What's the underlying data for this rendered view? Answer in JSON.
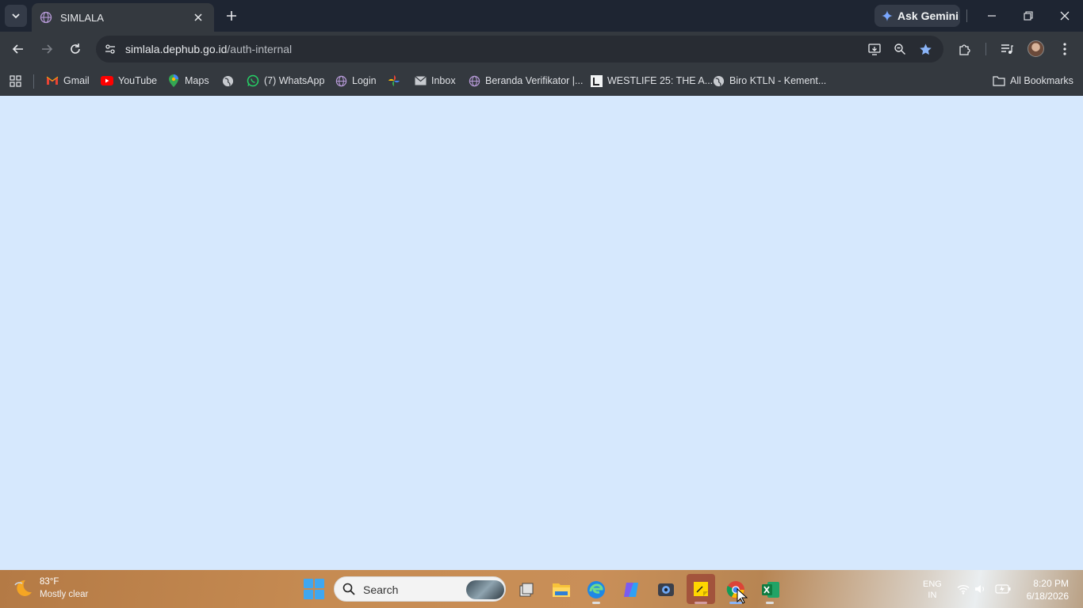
{
  "browser": {
    "tab": {
      "title": "SIMLALA"
    },
    "gemini_label": "Ask Gemini",
    "url": {
      "host": "simlala.dephub.go.id",
      "path": "/auth-internal"
    }
  },
  "bookmarks": [
    {
      "label": "Gmail",
      "icon": "gmail-icon"
    },
    {
      "label": "YouTube",
      "icon": "youtube-icon"
    },
    {
      "label": "Maps",
      "icon": "maps-icon"
    },
    {
      "label": "",
      "icon": "globe-icon"
    },
    {
      "label": "(7) WhatsApp",
      "icon": "whatsapp-icon"
    },
    {
      "label": "Login",
      "icon": "globe-icon"
    },
    {
      "label": "",
      "icon": "pinwheel-icon"
    },
    {
      "label": "Inbox",
      "icon": "mail-icon"
    },
    {
      "label": "Beranda Verifikator |...",
      "icon": "globe-icon"
    },
    {
      "label": "WESTLIFE 25: THE A...",
      "icon": "letter-l-icon"
    },
    {
      "label": "Biro KTLN - Kement...",
      "icon": "globe-icon"
    }
  ],
  "all_bookmarks_label": "All Bookmarks",
  "taskbar": {
    "weather": {
      "temp": "83°F",
      "desc": "Mostly clear"
    },
    "search_label": "Search",
    "apps": [
      "task-view",
      "file-explorer",
      "edge",
      "copilot",
      "camera",
      "sticky-notes",
      "chrome",
      "excel"
    ],
    "lang": {
      "line1": "ENG",
      "line2": "IN"
    },
    "clock": {
      "time": "8:20 PM",
      "date": "6/18/2026"
    }
  },
  "colors": {
    "page_background": "#d6e8fd",
    "tabstrip": "#1e2532",
    "toolbar": "#34393f",
    "star_active": "#8ab4f8"
  }
}
